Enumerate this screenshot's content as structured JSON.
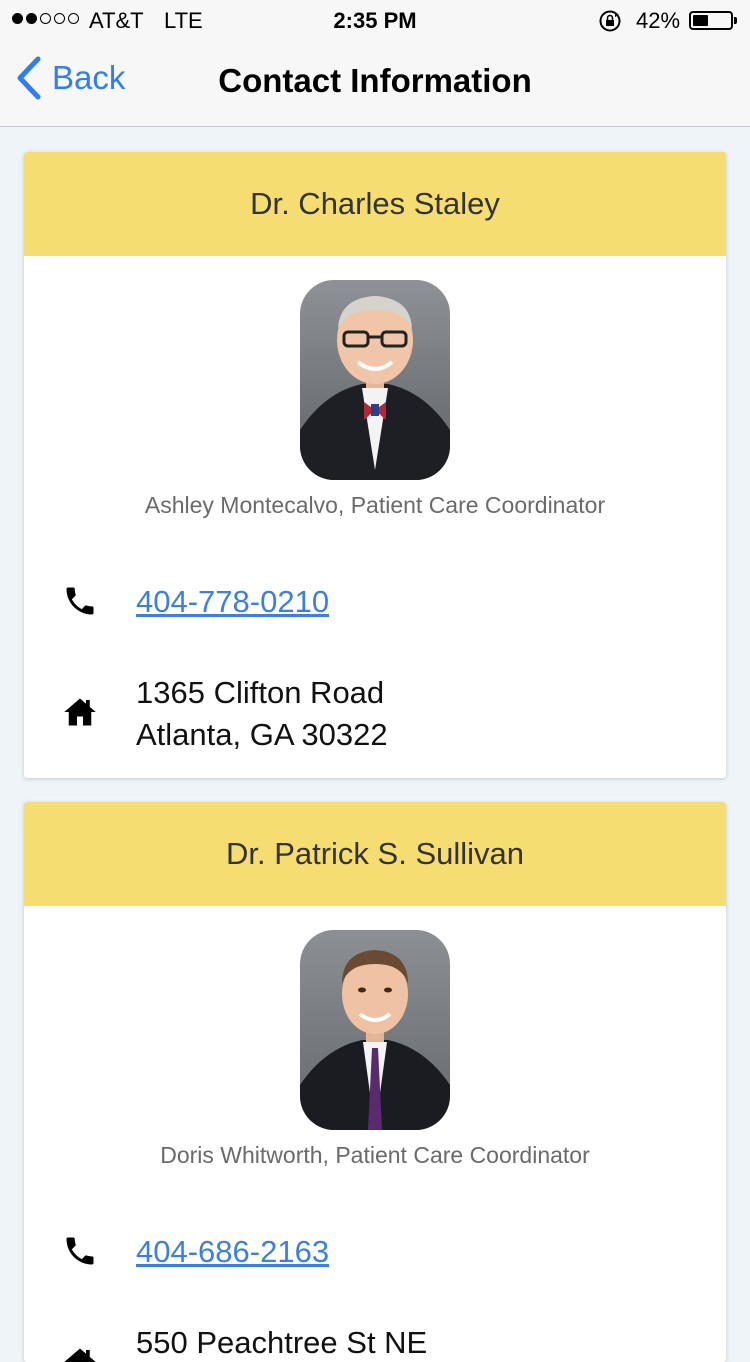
{
  "status": {
    "carrier": "AT&T",
    "network": "LTE",
    "time": "2:35 PM",
    "battery_pct": "42%",
    "battery_level": 0.42,
    "signal_bars_filled": 2,
    "signal_bars_total": 5
  },
  "nav": {
    "back_label": "Back",
    "title": "Contact Information"
  },
  "contacts": [
    {
      "name": "Dr. Charles Staley",
      "coordinator": "Ashley Montecalvo, Patient Care Coordinator",
      "phone": "404-778-0210",
      "address_line1": "1365 Clifton Road",
      "address_line2": "Atlanta, GA 30322"
    },
    {
      "name": "Dr. Patrick S. Sullivan",
      "coordinator": "Doris Whitworth, Patient Care Coordinator",
      "phone": "404-686-2163",
      "address_line1": "550 Peachtree St NE",
      "address_line2": ""
    }
  ],
  "colors": {
    "header_yellow": "#f5dd72",
    "link_blue": "#3d7fe0",
    "ios_blue": "#2f7ef2",
    "page_bg": "#eef4f7"
  },
  "icons": {
    "phone": "phone-icon",
    "home": "home-icon",
    "back": "chevron-left-icon",
    "lock": "rotation-lock-icon"
  }
}
